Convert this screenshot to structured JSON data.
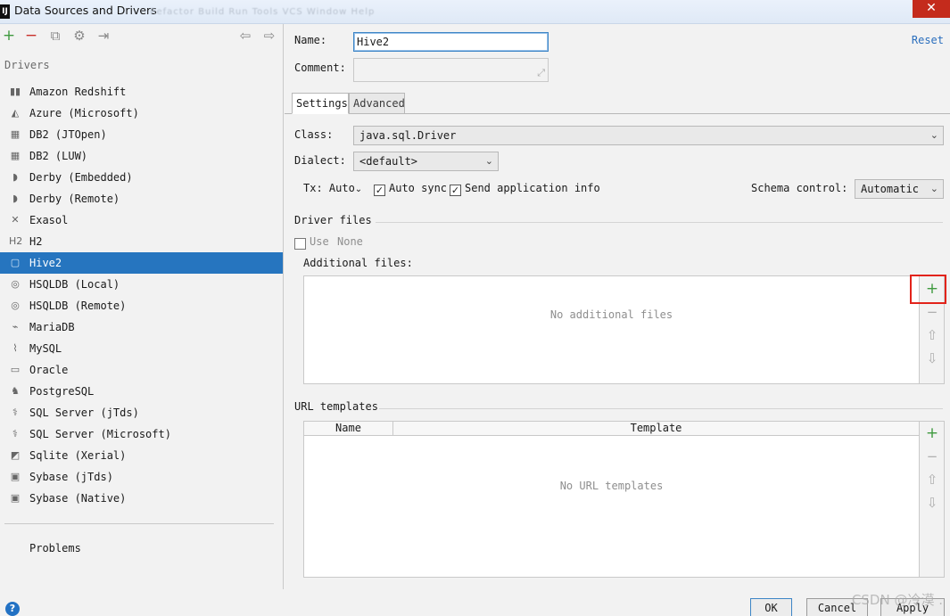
{
  "window": {
    "title": "Data Sources and Drivers",
    "app_icon": "IJ",
    "close_glyph": "✕",
    "background_menu": "Refactor  Build  Run  Tools  VCS  Window  Help"
  },
  "toolbar": {
    "add": "+",
    "remove": "−",
    "copy": "⧉",
    "settings": "⚙",
    "import": "⇥",
    "back": "⇦",
    "forward": "⇨"
  },
  "drivers_label": "Drivers",
  "drivers": [
    {
      "label": "Amazon Redshift",
      "icon": "▮▮"
    },
    {
      "label": "Azure (Microsoft)",
      "icon": "◭"
    },
    {
      "label": "DB2 (JTOpen)",
      "icon": "▦"
    },
    {
      "label": "DB2 (LUW)",
      "icon": "▦"
    },
    {
      "label": "Derby (Embedded)",
      "icon": "◗"
    },
    {
      "label": "Derby (Remote)",
      "icon": "◗"
    },
    {
      "label": "Exasol",
      "icon": "✕"
    },
    {
      "label": "H2",
      "icon": "H2"
    },
    {
      "label": "Hive2",
      "icon": "▢",
      "selected": true
    },
    {
      "label": "HSQLDB (Local)",
      "icon": "◎"
    },
    {
      "label": "HSQLDB (Remote)",
      "icon": "◎"
    },
    {
      "label": "MariaDB",
      "icon": "⌁"
    },
    {
      "label": "MySQL",
      "icon": "⌇"
    },
    {
      "label": "Oracle",
      "icon": "▭"
    },
    {
      "label": "PostgreSQL",
      "icon": "♞"
    },
    {
      "label": "SQL Server (jTds)",
      "icon": "⚕"
    },
    {
      "label": "SQL Server (Microsoft)",
      "icon": "⚕"
    },
    {
      "label": "Sqlite (Xerial)",
      "icon": "◩"
    },
    {
      "label": "Sybase (jTds)",
      "icon": "▣"
    },
    {
      "label": "Sybase (Native)",
      "icon": "▣"
    }
  ],
  "problems_label": "Problems",
  "form": {
    "name_label": "Name:",
    "name_value": "Hive2",
    "comment_label": "Comment:",
    "reset_label": "Reset",
    "tabs": [
      "Settings",
      "Advanced"
    ],
    "class_label": "Class:",
    "class_value": "java.sql.Driver",
    "dialect_label": "Dialect:",
    "dialect_value": "<default>",
    "tx_label": "Tx: Auto",
    "auto_sync_label": "Auto sync",
    "send_info_label": "Send application info",
    "schema_label": "Schema control:",
    "schema_value": "Automatic",
    "driver_files_title": "Driver files",
    "use_label": "Use",
    "use_value": "None",
    "additional_label": "Additional files:",
    "no_files_text": "No additional files",
    "url_title": "URL templates",
    "col_name": "Name",
    "col_template": "Template",
    "no_url_text": "No URL templates"
  },
  "side_buttons": {
    "add": "+",
    "remove": "−",
    "up": "⇧",
    "down": "⇩"
  },
  "buttons": {
    "help": "?",
    "ok": "OK",
    "cancel": "Cancel",
    "apply": "Apply"
  },
  "watermark": "CSDN @冷漠 ."
}
